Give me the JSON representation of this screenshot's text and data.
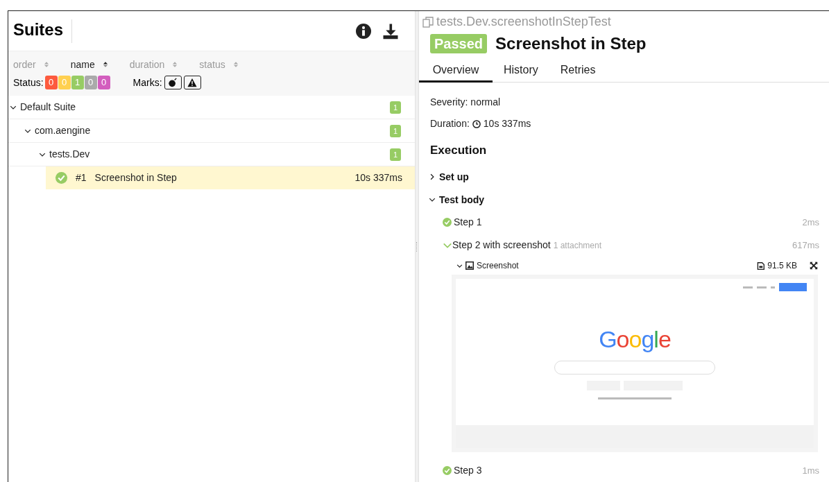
{
  "suites_panel": {
    "title": "Suites",
    "sort_options": [
      {
        "label": "order",
        "selected": false
      },
      {
        "label": "name",
        "selected": true
      },
      {
        "label": "duration",
        "selected": false
      },
      {
        "label": "status",
        "selected": false
      }
    ],
    "status_filter": {
      "label": "Status:",
      "counts": [
        {
          "value": "0",
          "color": "#fd5a3e"
        },
        {
          "value": "0",
          "color": "#ffd050"
        },
        {
          "value": "1",
          "color": "#97cc64"
        },
        {
          "value": "0",
          "color": "#aaaaaa"
        },
        {
          "value": "0",
          "color": "#d35ebe"
        }
      ]
    },
    "marks": {
      "label": "Marks:"
    },
    "tree": [
      {
        "kind": "group",
        "name": "Default Suite",
        "count": "1",
        "expanded": true,
        "children": [
          {
            "kind": "group",
            "name": "com.aengine",
            "count": "1",
            "expanded": true,
            "children": [
              {
                "kind": "group",
                "name": "tests.Dev",
                "count": "1",
                "expanded": true,
                "children": [
                  {
                    "kind": "test",
                    "order": "#1",
                    "name": "Screenshot in Step",
                    "duration": "10s 337ms",
                    "passed": true,
                    "selected": true
                  }
                ]
              }
            ]
          }
        ]
      }
    ]
  },
  "test_detail": {
    "full_name": "tests.Dev.screenshotInStepTest",
    "status": "Passed",
    "title": "Screenshot in Step",
    "tabs": [
      {
        "label": "Overview",
        "selected": true
      },
      {
        "label": "History",
        "selected": false
      },
      {
        "label": "Retries",
        "selected": false
      }
    ],
    "severity": "Severity: normal",
    "duration_label": "Duration:",
    "duration": "10s 337ms",
    "execution_title": "Execution",
    "sections": [
      {
        "name": "Set up",
        "expanded": false
      },
      {
        "name": "Test body",
        "expanded": true,
        "steps": [
          {
            "kind": "leaf",
            "name": "Step 1",
            "duration": "2ms"
          },
          {
            "kind": "parent",
            "name": "Step 2 with screenshot",
            "attachments_label": "1 attachment",
            "duration": "617ms",
            "attachments": [
              {
                "name": "Screenshot",
                "size": "91.5 KB",
                "expanded": true,
                "preview": {
                  "logo": "Google"
                }
              }
            ]
          },
          {
            "kind": "leaf",
            "name": "Step 3",
            "duration": "1ms"
          }
        ]
      }
    ]
  }
}
